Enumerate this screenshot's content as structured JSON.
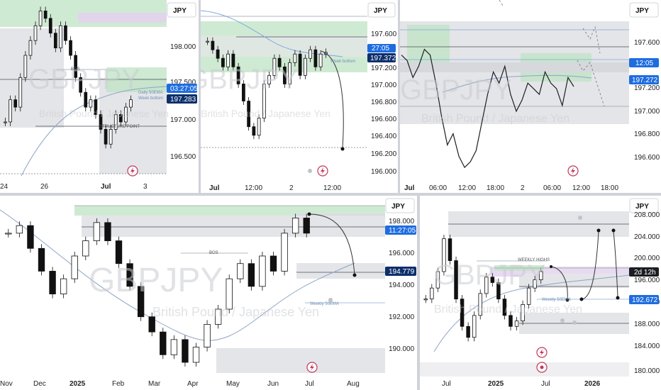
{
  "currency": "JPY",
  "colors": {
    "price_badge_blue": "#1e6de0",
    "price_badge_navy": "#0d2f6b",
    "price_badge_black": "#1b1d22",
    "zone_green": "#bfe3c4",
    "zone_purple": "#e3cff0",
    "bolt_pink": "#c0395a"
  },
  "watermark": {
    "symbol": "GBPJPY",
    "description": "British Pound / Japanese Yen"
  },
  "panels": [
    {
      "id": "p1",
      "currency": "JPY",
      "y_ticks": [
        "198.000",
        "197.500",
        "197.000",
        "196.500"
      ],
      "x_ticks": [
        "24",
        "26",
        "Jul",
        "3"
      ],
      "badges": [
        {
          "text": "03:27:05",
          "color": "#1e6de0"
        },
        {
          "text": "197.283",
          "color": "#0d2f6b"
        }
      ],
      "labels": [
        "BOS",
        "STRUCTURE POINT",
        "Daily 50EMA",
        "Week bottom"
      ],
      "chart_data": {
        "type": "candlestick",
        "ylim": [
          196.3,
          198.6
        ],
        "close": [
          197.0,
          197.3,
          197.2,
          197.6,
          197.9,
          198.1,
          198.3,
          198.5,
          198.4,
          198.2,
          198.0,
          198.3,
          198.1,
          197.9,
          197.6,
          197.4,
          197.2,
          197.3,
          197.1,
          196.9,
          196.7,
          196.9,
          197.1,
          197.0,
          197.2,
          197.3
        ]
      }
    },
    {
      "id": "p2",
      "currency": "JPY",
      "y_ticks": [
        "197.600",
        "197.400",
        "197.200",
        "197.000",
        "196.800",
        "196.600",
        "196.400",
        "196.200",
        "196.000"
      ],
      "x_ticks": [
        "Jul",
        "12:00",
        "2",
        "12:00"
      ],
      "badges": [
        {
          "text": "27:05",
          "color": "#1e6de0"
        },
        {
          "text": "197.372",
          "color": "#0d2f6b"
        }
      ],
      "labels": [
        "Week bottom"
      ],
      "chart_data": {
        "type": "candlestick",
        "ylim": [
          195.95,
          197.75
        ],
        "close": [
          197.5,
          197.4,
          197.3,
          197.2,
          197.35,
          197.2,
          197.0,
          196.8,
          196.5,
          196.4,
          196.6,
          197.0,
          197.1,
          197.3,
          197.2,
          197.0,
          197.25,
          197.35,
          197.1,
          197.3,
          197.4,
          197.2,
          197.35,
          197.37
        ]
      },
      "target_price": 196.25
    },
    {
      "id": "p3",
      "currency": "JPY",
      "y_ticks": [
        "197.600",
        "197.200",
        "197.000",
        "196.800",
        "196.600"
      ],
      "x_ticks": [
        "Jul",
        "06:00",
        "12:00",
        "18:00",
        "2",
        "06:00",
        "12:00",
        "18:00"
      ],
      "badges": [
        {
          "text": "12:05",
          "color": "#1e6de0"
        },
        {
          "text": "197.272",
          "color": "#0d2f6b"
        }
      ],
      "chart_data": {
        "type": "line",
        "ylim": [
          196.45,
          197.85
        ],
        "values": [
          197.55,
          197.5,
          197.35,
          197.45,
          197.6,
          197.55,
          197.3,
          197.0,
          196.75,
          196.85,
          196.65,
          196.55,
          196.6,
          196.7,
          196.95,
          197.2,
          197.4,
          197.3,
          197.45,
          197.2,
          197.05,
          197.15,
          197.3,
          197.25,
          197.2,
          197.4,
          197.3,
          197.25,
          197.1,
          197.35,
          197.27
        ]
      }
    },
    {
      "id": "p4",
      "currency": "JPY",
      "y_ticks": [
        "198.000",
        "196.000",
        "194.000",
        "192.000",
        "190.000"
      ],
      "x_ticks": [
        "Nov",
        "Dec",
        "2025",
        "Feb",
        "Mar",
        "Apr",
        "May",
        "Jun",
        "Jul",
        "Aug"
      ],
      "badges": [
        {
          "text": "11:27:05",
          "color": "#1e6de0"
        },
        {
          "text": "194.779",
          "color": "#0d2f6b"
        }
      ],
      "labels": [
        "BOS",
        "Weekly 50EMA"
      ],
      "chart_data": {
        "type": "candlestick",
        "ylim": [
          188.3,
          199.5
        ],
        "close": [
          197.5,
          198.0,
          196.5,
          195.0,
          193.5,
          194.5,
          196.0,
          197.0,
          198.2,
          197.0,
          195.5,
          194.0,
          192.0,
          191.0,
          189.5,
          190.5,
          189.0,
          190.0,
          191.5,
          192.5,
          194.5,
          195.5,
          194.0,
          196.0,
          195.0,
          197.5,
          198.5,
          197.5
        ]
      }
    },
    {
      "id": "p5",
      "currency": "JPY",
      "y_ticks": [
        "208.000",
        "204.000",
        "200.000",
        "196.000",
        "192.000",
        "188.000",
        "184.000",
        "180.000"
      ],
      "x_ticks": [
        "Jul",
        "2025",
        "Jul",
        "2026"
      ],
      "badges": [
        {
          "text": "2d 12h",
          "color": "#1b1d22"
        },
        {
          "text": "192.672",
          "color": "#1e6de0"
        }
      ],
      "labels": [
        "WEEKLY HIGHS",
        "Weekly 50EMA"
      ],
      "chart_data": {
        "type": "candlestick",
        "ylim": [
          179.5,
          209.0
        ],
        "close": [
          193.0,
          195.0,
          198.0,
          204.0,
          200.0,
          193.0,
          188.0,
          186.0,
          190.0,
          194.0,
          197.0,
          196.0,
          193.0,
          190.0,
          188.0,
          189.0,
          192.0,
          195.0,
          196.5,
          198.0
        ]
      }
    }
  ]
}
